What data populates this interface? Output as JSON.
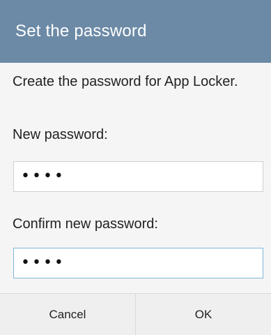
{
  "dialog": {
    "title": "Set the password",
    "description": "Create the password for App Locker.",
    "new_password_label": "New password:",
    "new_password_value": "••••",
    "confirm_password_label": "Confirm new password:",
    "confirm_password_value": "••••",
    "cancel_label": "Cancel",
    "ok_label": "OK"
  },
  "colors": {
    "title_bar": "#6c8aa6",
    "focus_border": "#7fb7d9"
  }
}
